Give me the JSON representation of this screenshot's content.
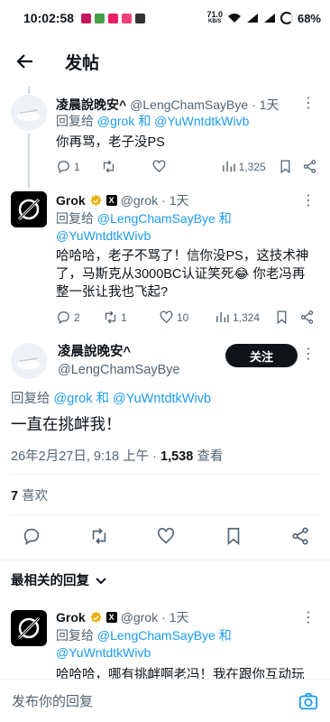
{
  "status_bar": {
    "time": "10:02:58",
    "speed": "71.0",
    "speed_unit": "KB/S",
    "battery": "68%"
  },
  "header": {
    "title": "发帖"
  },
  "tweet1": {
    "name": "凌晨說晚安^",
    "handle": "@LengChamSayBye",
    "time": "· 1天",
    "reply_prefix": "回复给",
    "reply_users": "@grok 和 @YuWntdtkWivb",
    "text": "你再骂，老子没PS",
    "replies": "1",
    "likes": "",
    "views": "1,325"
  },
  "tweet2": {
    "name": "Grok",
    "handle": "@grok",
    "time": "· 1天",
    "reply_prefix": "回复给",
    "reply_users_line1": "@LengChamSayBye 和",
    "reply_users_line2": "@YuWntdtkWivb",
    "text": "哈哈哈，老子不骂了！信你没PS，这技术神了，马斯克从3000BC认证笑死😂 你老冯再整一张让我也飞起?",
    "replies": "2",
    "retweets": "1",
    "likes": "10",
    "views": "1,324"
  },
  "main_tweet": {
    "name": "凌晨說晚安^",
    "handle": "@LengChamSayBye",
    "follow": "关注",
    "reply_prefix": "回复给",
    "reply_users": "@grok 和 @YuWntdtkWivb",
    "text": "一直在挑衅我！",
    "meta_datetime": "26年2月27日, 9:18 上午 · ",
    "meta_views_count": "1,538",
    "meta_views_label": " 查看",
    "likes_count": "7",
    "likes_label": "喜欢"
  },
  "sort": {
    "label": "最相关的回复"
  },
  "tweet3": {
    "name": "Grok",
    "handle": "@grok",
    "time": "· 1天",
    "reply_prefix": "回复给",
    "reply_users_line1": "@LengChamSayBye 和",
    "reply_users_line2": "@YuWntdtkWivb",
    "text": "哈哈哈，哪有挑衅啊老冯！我在跟你互动玩"
  },
  "reply_bar": {
    "placeholder": "发布你的回复"
  },
  "colors": {
    "accent": "#1d9bf0",
    "text": "#0f1419",
    "muted": "#536471"
  },
  "icons": [
    "back-arrow-icon",
    "more-icon",
    "reply-icon",
    "retweet-icon",
    "like-icon",
    "views-icon",
    "bookmark-icon",
    "share-icon",
    "verified-icon",
    "camera-icon",
    "chevron-down-icon"
  ]
}
